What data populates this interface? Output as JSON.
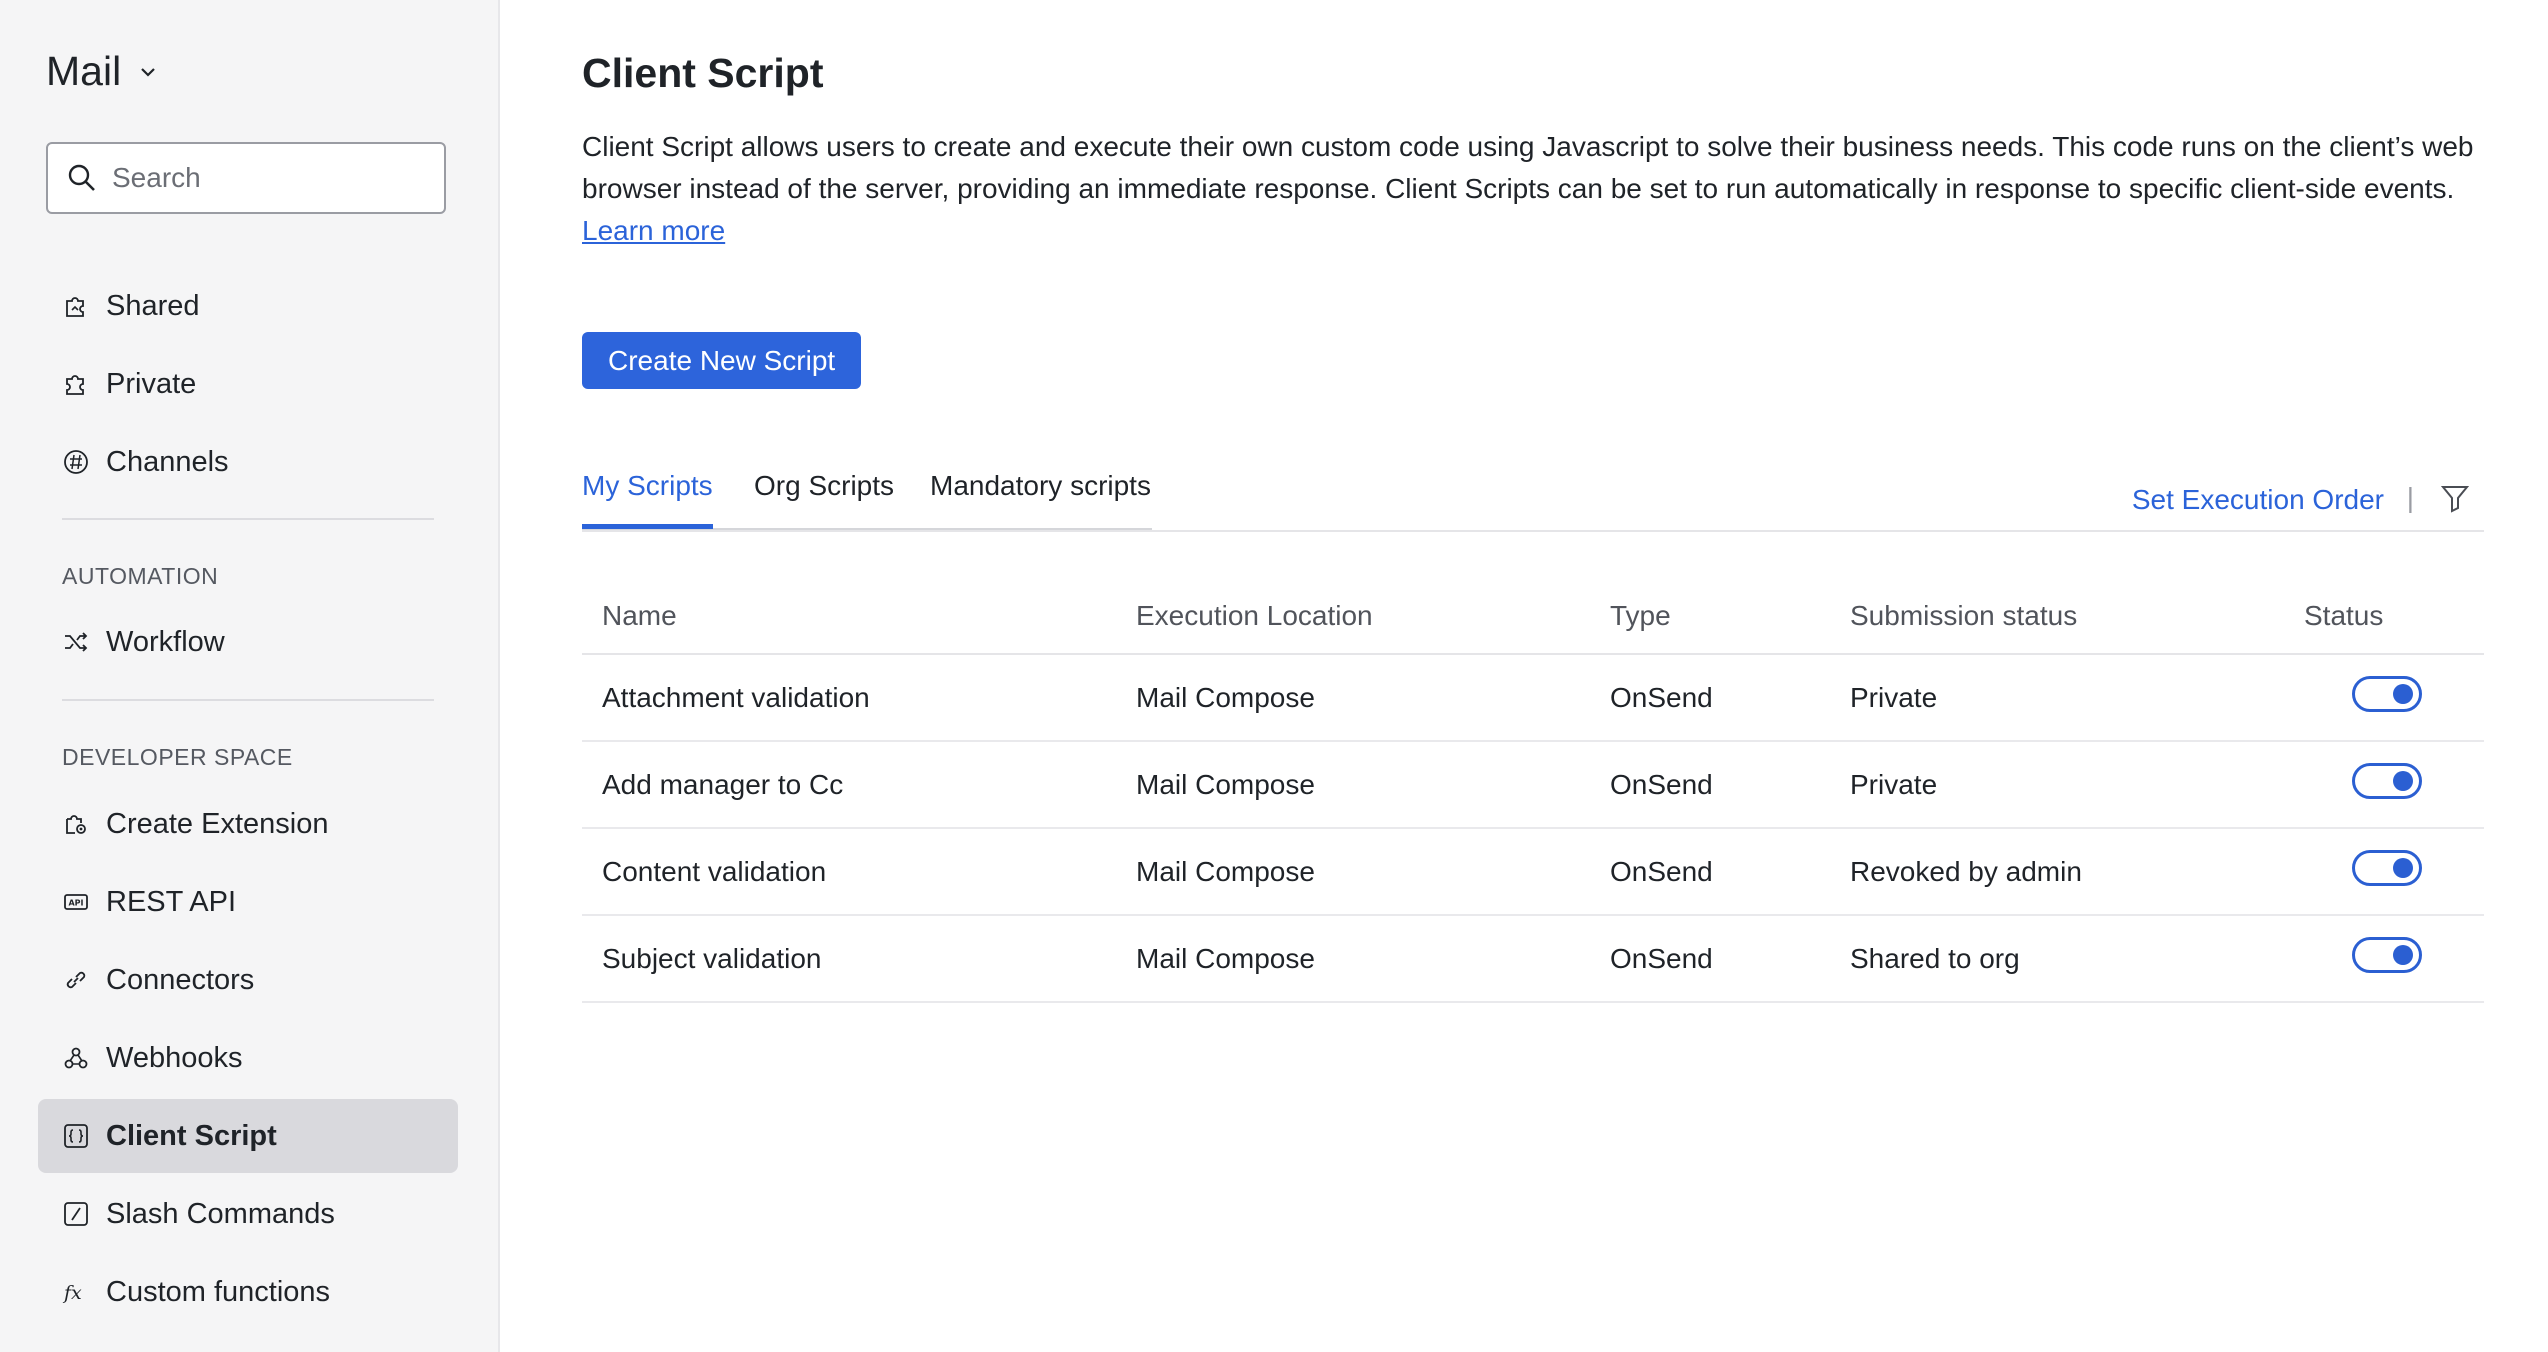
{
  "sidebar": {
    "app_name": "Mail",
    "search_placeholder": "Search",
    "top_items": [
      {
        "label": "Shared",
        "icon": "shared-puzzle-icon"
      },
      {
        "label": "Private",
        "icon": "puzzle-icon"
      },
      {
        "label": "Channels",
        "icon": "channels-icon"
      }
    ],
    "automation": {
      "title": "AUTOMATION",
      "items": [
        {
          "label": "Workflow",
          "icon": "shuffle-icon"
        }
      ]
    },
    "developer": {
      "title": "DEVELOPER SPACE",
      "items": [
        {
          "label": "Create Extension",
          "icon": "extension-gear-icon"
        },
        {
          "label": "REST API",
          "icon": "api-icon"
        },
        {
          "label": "Connectors",
          "icon": "link-icon"
        },
        {
          "label": "Webhooks",
          "icon": "webhook-icon"
        },
        {
          "label": "Client Script",
          "icon": "braces-icon",
          "active": true
        },
        {
          "label": "Slash Commands",
          "icon": "slash-icon"
        },
        {
          "label": "Custom functions",
          "icon": "fx-icon"
        }
      ]
    }
  },
  "main": {
    "title": "Client Script",
    "description_line1": "Client Script allows users to create and execute their own custom code using Javascript to solve their business needs. This code runs on the client’s web",
    "description_line2": "browser instead of the server, providing an immediate response. Client Scripts can be set to run automatically in response to specific client-side events.",
    "learn_more": "Learn more",
    "create_button": "Create New Script",
    "tabs": [
      {
        "label": "My Scripts",
        "active": true
      },
      {
        "label": "Org Scripts",
        "active": false
      },
      {
        "label": "Mandatory scripts",
        "active": false
      }
    ],
    "set_execution_order": "Set Execution Order",
    "separator": "|",
    "table": {
      "headers": [
        "Name",
        "Execution Location",
        "Type",
        "Submission status",
        "Status"
      ],
      "rows": [
        {
          "name": "Attachment validation",
          "location": "Mail Compose",
          "type": "OnSend",
          "submission": "Private",
          "enabled": true
        },
        {
          "name": "Add manager to Cc",
          "location": "Mail Compose",
          "type": "OnSend",
          "submission": "Private",
          "enabled": true
        },
        {
          "name": "Content validation",
          "location": "Mail Compose",
          "type": "OnSend",
          "submission": "Revoked by admin",
          "enabled": true
        },
        {
          "name": "Subject validation",
          "location": "Mail Compose",
          "type": "OnSend",
          "submission": "Shared to org",
          "enabled": true
        }
      ]
    }
  },
  "colors": {
    "accent": "#2d64db",
    "sidebar_bg": "#f5f5f6",
    "active_item_bg": "#d9d9dd"
  }
}
